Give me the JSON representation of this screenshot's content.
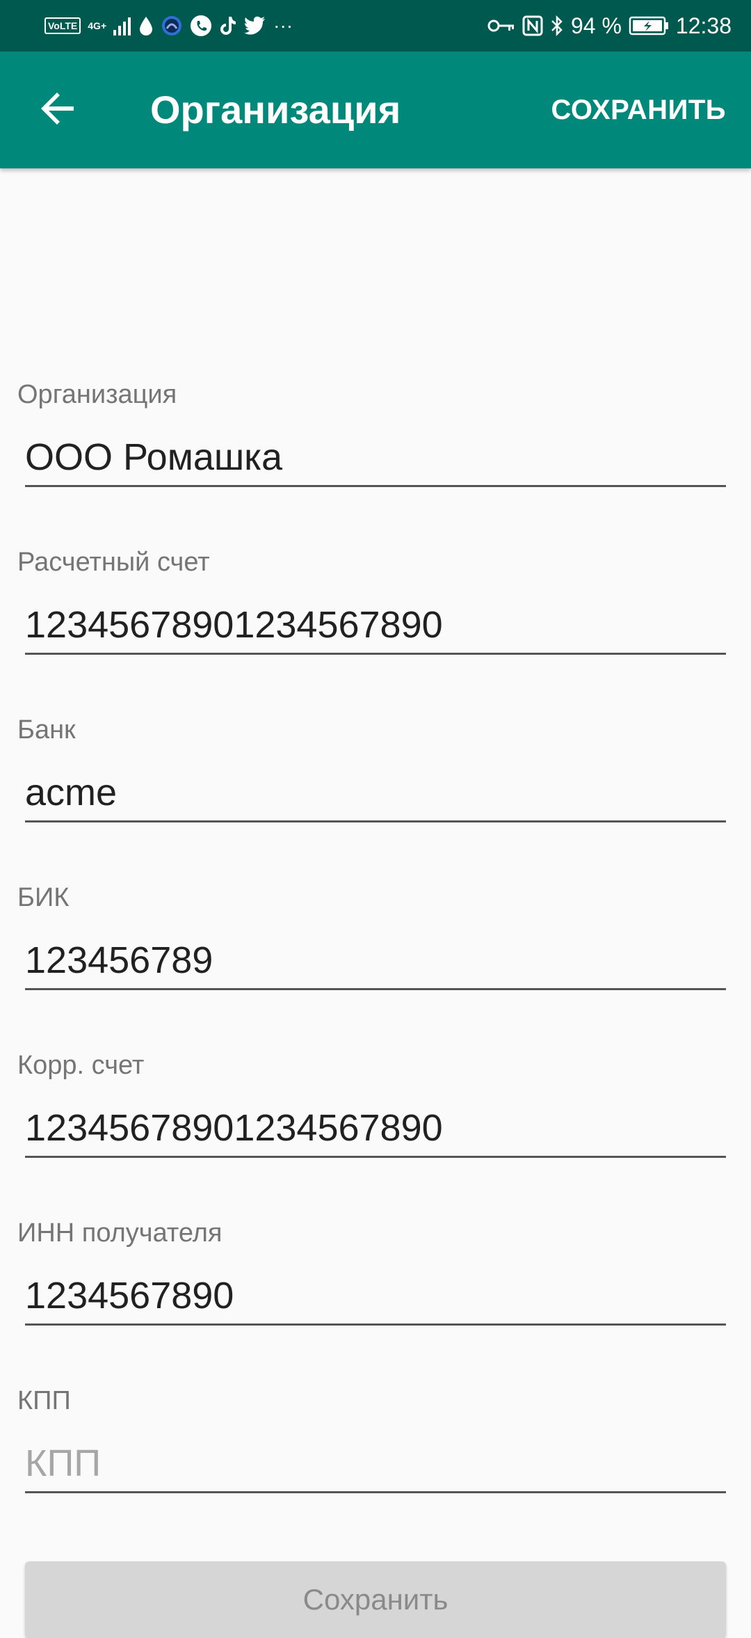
{
  "status_bar": {
    "volte": "VoLTE",
    "network": "4G+",
    "more": "···",
    "battery_percent": "94 %",
    "time": "12:38",
    "colors": {
      "background": "#00594f"
    },
    "icons": [
      "volte-icon",
      "signal-icon",
      "drop-icon",
      "app-icon",
      "phone-icon",
      "tiktok-icon",
      "twitter-icon",
      "more-icon",
      "key-icon",
      "nfc-icon",
      "bluetooth-icon",
      "battery-icon"
    ]
  },
  "app_bar": {
    "title": "Организация",
    "save_label": "СОХРАНИТЬ",
    "back_icon": "arrow-left-icon",
    "colors": {
      "background": "#00897b",
      "text": "#ffffff"
    }
  },
  "form": {
    "fields": [
      {
        "label": "Организация",
        "value": "ООО Ромашка",
        "placeholder": ""
      },
      {
        "label": "Расчетный счет",
        "value": "12345678901234567890",
        "placeholder": ""
      },
      {
        "label": "Банк",
        "value": "acme",
        "placeholder": ""
      },
      {
        "label": "БИК",
        "value": "123456789",
        "placeholder": ""
      },
      {
        "label": "Корр. счет",
        "value": "12345678901234567890",
        "placeholder": ""
      },
      {
        "label": "ИНН получателя",
        "value": "1234567890",
        "placeholder": ""
      },
      {
        "label": "КПП",
        "value": "",
        "placeholder": "КПП"
      }
    ]
  },
  "bottom_button": {
    "label": "Сохранить",
    "colors": {
      "background": "#d6d6d6",
      "text": "#8a8a8a"
    }
  }
}
